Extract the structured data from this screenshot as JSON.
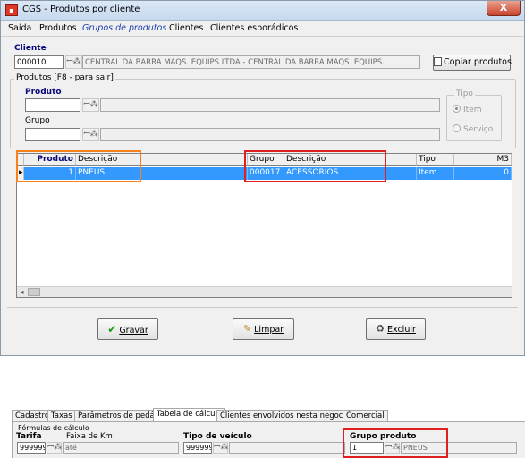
{
  "window": {
    "title": "CGS - Produtos por cliente",
    "close_glyph": "X"
  },
  "menu": [
    "Saída",
    "Produtos",
    "Grupos de produtos",
    "Clientes",
    "Clientes esporádicos"
  ],
  "cliente": {
    "label": "Cliente",
    "code": "000010",
    "name": "CENTRAL DA BARRA MAQS. EQUIPS.LTDA - CENTRAL DA BARRA MAQS. EQUIPS.",
    "copy_button": "Copiar produtos"
  },
  "produtos_group": {
    "title": "Produtos [F8 - para sair]",
    "produto_label": "Produto",
    "grupo_label": "Grupo",
    "tipo_label": "Tipo",
    "tipo_options": [
      "Item",
      "Serviço"
    ],
    "tipo_selected": "Item"
  },
  "grid": {
    "columns": [
      "Produto",
      "Descrição",
      "Grupo",
      "Descrição",
      "Tipo",
      "M3"
    ],
    "rows": [
      {
        "produto": "1",
        "descricao": "PNEUS",
        "grupo": "000017",
        "grupo_descricao": "ACESSORIOS",
        "tipo": "Item",
        "m3": "0"
      }
    ]
  },
  "buttons": {
    "gravar": "Gravar",
    "limpar": "Limpar",
    "excluir": "Excluir"
  },
  "bottom": {
    "tabs": [
      "Cadastro",
      "Taxas",
      "Parâmetros de pedágio",
      "Tabela de cálculo",
      "Clientes envolvidos nesta negociação",
      "Comercial"
    ],
    "active_tab": "Tabela de cálculo",
    "formulas_title": "Fórmulas de cálculo",
    "tarifa_label": "Tarifa",
    "tarifa_value": "999999",
    "faixa_label": "Faixa de Km",
    "faixa_placeholder": "até",
    "tipo_veiculo_label": "Tipo de veículo",
    "tipo_veiculo_value": "999999",
    "grupo_produto_label": "Grupo produto",
    "grupo_produto_code": "1",
    "grupo_produto_name": "PNEUS"
  },
  "colors": {
    "selection": "#3399ff",
    "orange_highlight": "#f5821f",
    "red_highlight": "#e02020",
    "label_blue": "#0a0a7a"
  }
}
